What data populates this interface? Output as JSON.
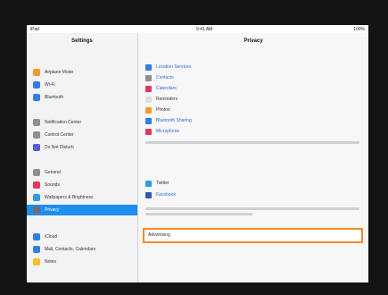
{
  "statusbar": {
    "carrier": "iPad",
    "time": "9:41 AM",
    "battery": "100%"
  },
  "sidebar": {
    "title": "Settings",
    "items": [
      {
        "label": "Airplane Mode",
        "color": "#f29a2e"
      },
      {
        "label": "Wi-Fi",
        "color": "#2f7ee6"
      },
      {
        "label": "Bluetooth",
        "color": "#2f7ee6"
      },
      {
        "label": "Notification Center",
        "color": "#8e8e93"
      },
      {
        "label": "Control Center",
        "color": "#8e8e93"
      },
      {
        "label": "Do Not Disturb",
        "color": "#5a5ad6"
      },
      {
        "label": "General",
        "color": "#8e8e93"
      },
      {
        "label": "Sounds",
        "color": "#e0385a"
      },
      {
        "label": "Wallpapers & Brightness",
        "color": "#2f9be6"
      },
      {
        "label": "Privacy",
        "color": "#6d6d72",
        "selected": true
      },
      {
        "label": "iCloud",
        "color": "#2f7ee6"
      },
      {
        "label": "Mail, Contacts, Calendars",
        "color": "#2f7ee6"
      },
      {
        "label": "Notes",
        "color": "#f2c12e"
      }
    ]
  },
  "main": {
    "title": "Privacy",
    "rows": [
      {
        "label": "Location Services",
        "color": "#2f7ee6"
      },
      {
        "label": "Contacts",
        "color": "#8e8e93"
      },
      {
        "label": "Calendars",
        "color": "#e0385a"
      },
      {
        "label": "Reminders",
        "color": "#dddddd"
      },
      {
        "label": "Photos",
        "color": "#f29a2e"
      },
      {
        "label": "Bluetooth Sharing",
        "color": "#2f7ee6"
      },
      {
        "label": "Microphone",
        "color": "#e0385a"
      }
    ],
    "social": [
      {
        "label": "Twitter",
        "color": "#2f9be6"
      },
      {
        "label": "Facebook",
        "color": "#2f5aa8"
      }
    ],
    "advertising_label": "Advertising"
  }
}
